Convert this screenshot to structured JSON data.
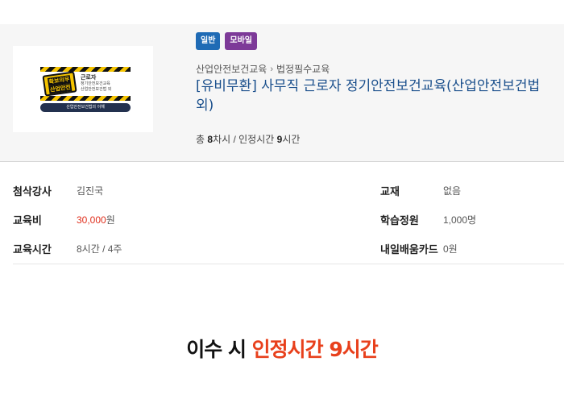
{
  "badges": {
    "general": "일반",
    "mobile": "모바일"
  },
  "thumbnail": {
    "sign_line1": "확보의무",
    "sign_line2": "산업안전",
    "heading": "근로자",
    "subheading": "정기안전보건교육",
    "subline": "산업안전보건법 외",
    "footer": "산업안전보건법의 이해",
    "colors": {
      "hazard_yellow": "#f5c400",
      "hazard_black": "#111111",
      "bar": "#23314f"
    }
  },
  "breadcrumb": {
    "category": "산업안전보건교육",
    "subcategory": "법정필수교육"
  },
  "course": {
    "title": "[유비무환] 사무직 근로자 정기안전보건교육(산업안전보건법 외)",
    "summary_prefix": "총 ",
    "sessions": "8",
    "summary_mid": "차시 / 인정시간 ",
    "hours": "9",
    "summary_suffix": "시간"
  },
  "info": {
    "instructor_label": "첨삭강사",
    "instructor_value": "김진국",
    "textbook_label": "교재",
    "textbook_value": "없음",
    "fee_label": "교육비",
    "fee_value": "30,000",
    "fee_unit": "원",
    "capacity_label": "학습정원",
    "capacity_value": "1,000명",
    "duration_label": "교육시간",
    "duration_value": "8시간 / 4주",
    "card_label": "내일배움카드",
    "card_value": "0원"
  },
  "promo": {
    "prefix": "이수 시 ",
    "highlight": "인정시간 9시간"
  },
  "colors": {
    "title_blue": "#1a4f8c",
    "price_red": "#e0301e",
    "promo_accent": "#e8401c",
    "badge_general": "#1f6bb5",
    "badge_mobile": "#7d3a98"
  }
}
